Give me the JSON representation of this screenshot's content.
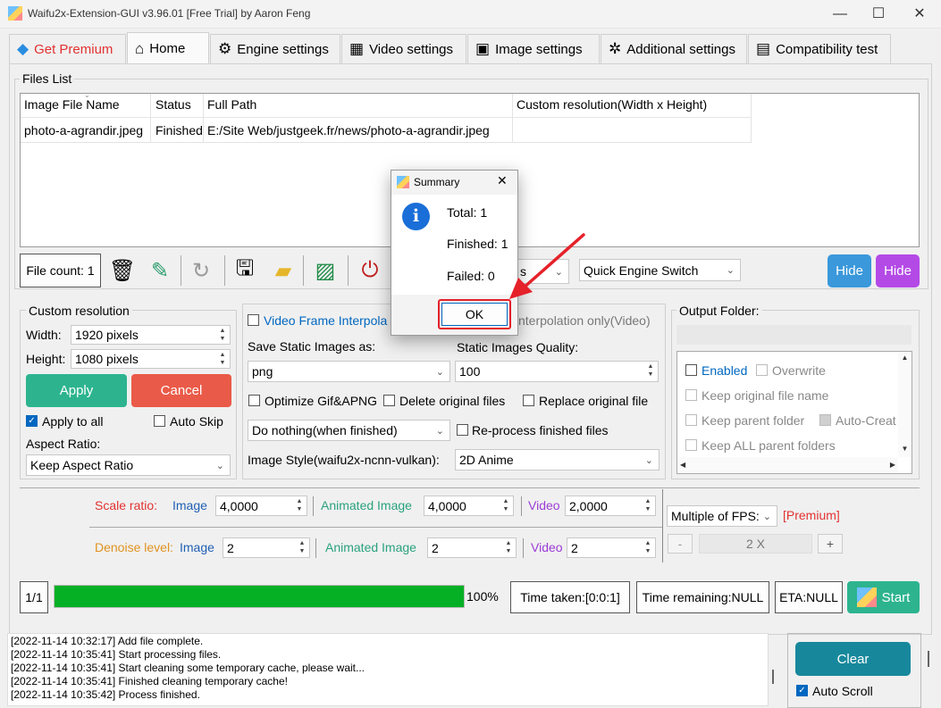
{
  "window": {
    "title": "Waifu2x-Extension-GUI v3.96.01 [Free Trial] by Aaron Feng",
    "minimize": "—",
    "maximize": "☐",
    "close": "✕"
  },
  "tabs": [
    {
      "label": "Get Premium",
      "icon": "gem-icon",
      "color": "#e33131"
    },
    {
      "label": "Home",
      "icon": "home-icon"
    },
    {
      "label": "Engine settings",
      "icon": "engine-icon"
    },
    {
      "label": "Video settings",
      "icon": "clapper-icon"
    },
    {
      "label": "Image settings",
      "icon": "image-icon"
    },
    {
      "label": "Additional settings",
      "icon": "gear-icon"
    },
    {
      "label": "Compatibility test",
      "icon": "monitor-icon"
    }
  ],
  "files": {
    "group": "Files List",
    "columns": [
      "Image File Name",
      "Status",
      "Full Path",
      "Custom resolution(Width x Height)"
    ],
    "rows": [
      [
        "photo-a-agrandir.jpeg",
        "Finished",
        "E:/Site Web/justgeek.fr/news/photo-a-agrandir.jpeg",
        ""
      ]
    ]
  },
  "toolbar": {
    "file_count": "File count: 1",
    "engine_suffix": "s",
    "quick_engine": "Quick Engine Switch",
    "hide1": "Hide",
    "hide2": "Hide"
  },
  "custom_res": {
    "title": "Custom resolution",
    "width_label": "Width:",
    "width_value": "1920 pixels",
    "height_label": "Height:",
    "height_value": "1080 pixels",
    "apply": "Apply",
    "cancel": "Cancel",
    "apply_all": "Apply to all",
    "auto_skip": "Auto Skip",
    "aspect_label": "Aspect Ratio:",
    "aspect_value": "Keep Aspect Ratio"
  },
  "middle": {
    "vfi": "Video Frame Interpola",
    "vfi_only": "nterpolation only(Video)",
    "save_label": "Save Static Images as:",
    "save_value": "png",
    "quality_label": "Static Images Quality:",
    "quality_value": "100",
    "optimize": "Optimize Gif&APNG",
    "delete": "Delete original files",
    "replace": "Replace original file",
    "finish_action": "Do nothing(when finished)",
    "reprocess": "Re-process finished files",
    "style_label": "Image Style(waifu2x-ncnn-vulkan):",
    "style_value": "2D Anime"
  },
  "output": {
    "title": "Output Folder:",
    "enabled": "Enabled",
    "overwrite": "Overwrite",
    "keep_name": "Keep original file name",
    "keep_parent": "Keep parent folder",
    "auto_create": "Auto-Creat",
    "keep_all": "Keep ALL parent folders"
  },
  "scale": {
    "label": "Scale ratio:",
    "image_label": "Image",
    "image_value": "4,0000",
    "anim_label": "Animated Image",
    "anim_value": "4,0000",
    "video_label": "Video",
    "video_value": "2,0000"
  },
  "denoise": {
    "label": "Denoise level:",
    "image_label": "Image",
    "image_value": "2",
    "anim_label": "Animated Image",
    "anim_value": "2",
    "video_label": "Video",
    "video_value": "2"
  },
  "fps": {
    "label": "Multiple of FPS:",
    "premium": "[Premium]",
    "minus": "-",
    "value": "2 X",
    "plus": "+"
  },
  "progress": {
    "pages": "1/1",
    "percent_text": "100%",
    "percent": 1.0,
    "time_taken": "Time taken:[0:0:1]",
    "time_remaining": "Time remaining:NULL",
    "eta": "ETA:NULL",
    "start": "Start"
  },
  "log": {
    "lines": [
      "[2022-11-14 10:32:17] Add file complete.",
      "[2022-11-14 10:35:41] Start processing files.",
      "[2022-11-14 10:35:41] Start cleaning some temporary cache, please wait...",
      "[2022-11-14 10:35:41] Finished cleaning temporary cache!",
      "[2022-11-14 10:35:42] Process finished."
    ]
  },
  "bottom": {
    "clear": "Clear",
    "auto_scroll": "Auto Scroll"
  },
  "dialog": {
    "title": "Summary",
    "total": "Total: 1",
    "finished": "Finished: 1",
    "failed": "Failed: 0",
    "ok": "OK",
    "close": "✕",
    "info": "i"
  },
  "colors": {
    "accent": "#0067c0",
    "progress": "#06b025",
    "teal": "#2db48f",
    "red_btn": "#ea5a48",
    "hide_blue": "#3a98db",
    "hide_purple": "#b44ae6",
    "highlight": "#e5212a",
    "arrow": "#e5212a"
  }
}
